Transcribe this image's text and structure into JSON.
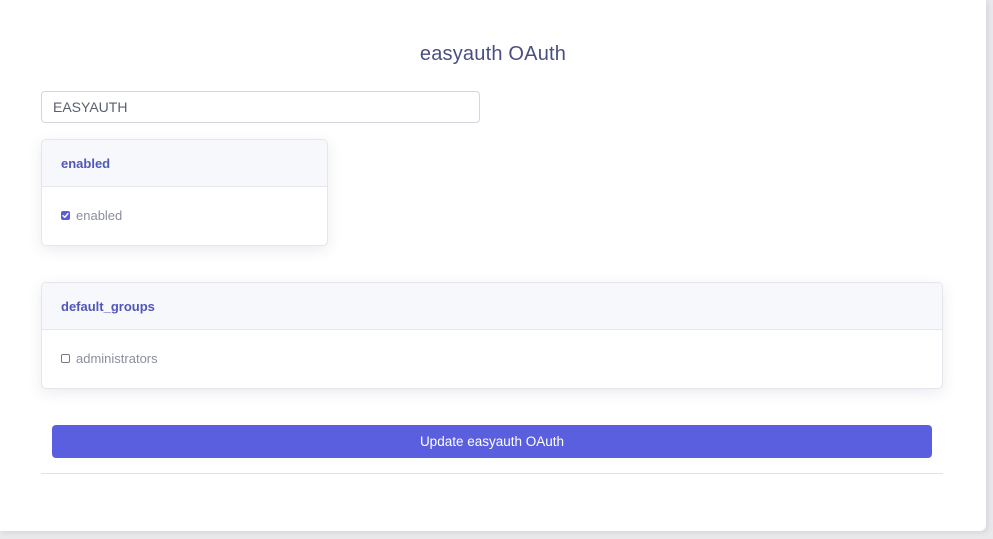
{
  "page": {
    "title": "easyauth OAuth"
  },
  "name_field": {
    "value": "EASYAUTH"
  },
  "enabled_section": {
    "header": "enabled",
    "option_label": "enabled",
    "checked": true
  },
  "default_groups_section": {
    "header": "default_groups",
    "options": [
      {
        "label": "administrators",
        "checked": false
      }
    ]
  },
  "submit": {
    "label": "Update easyauth OAuth"
  },
  "colors": {
    "accent": "#5a5fdf",
    "title": "#4a4f80",
    "section_header": "#5156b8"
  }
}
